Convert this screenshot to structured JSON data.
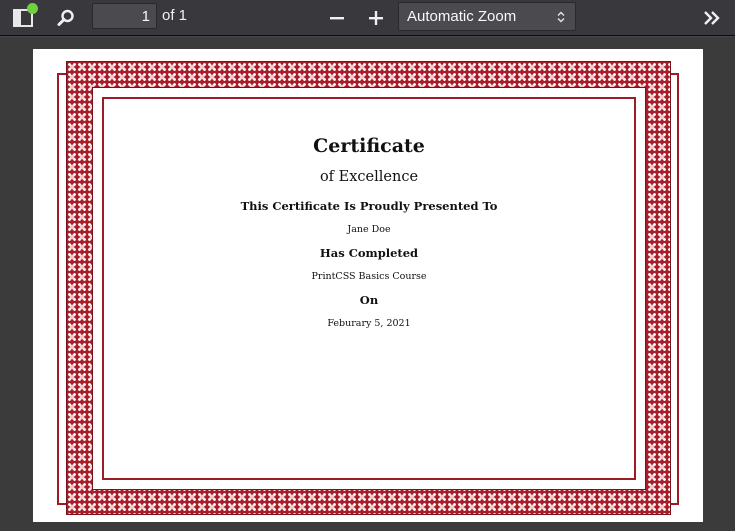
{
  "toolbar": {
    "page_number": "1",
    "page_of": "of 1",
    "zoom_selected": "Automatic Zoom",
    "icons": {
      "sidebar": "sidebar-toggle-icon",
      "search": "search-icon",
      "zoom_out": "minus-icon",
      "zoom_in": "plus-icon",
      "tools": "double-chevron-right-icon"
    }
  },
  "certificate": {
    "title": "Certificate",
    "subtitle": "of Excellence",
    "presented_to": "This Certificate Is Proudly Presented To",
    "recipient": "Jane Doe",
    "has_completed": "Has Completed",
    "course": "PrintCSS Basics Course",
    "on_label": "On",
    "date": "Feburary 5, 2021"
  },
  "colors": {
    "frame_red": "#a71d2a",
    "toolbar_bg": "#38383d",
    "viewer_bg": "#3b3b3b",
    "notification_green": "#6ed23f"
  }
}
